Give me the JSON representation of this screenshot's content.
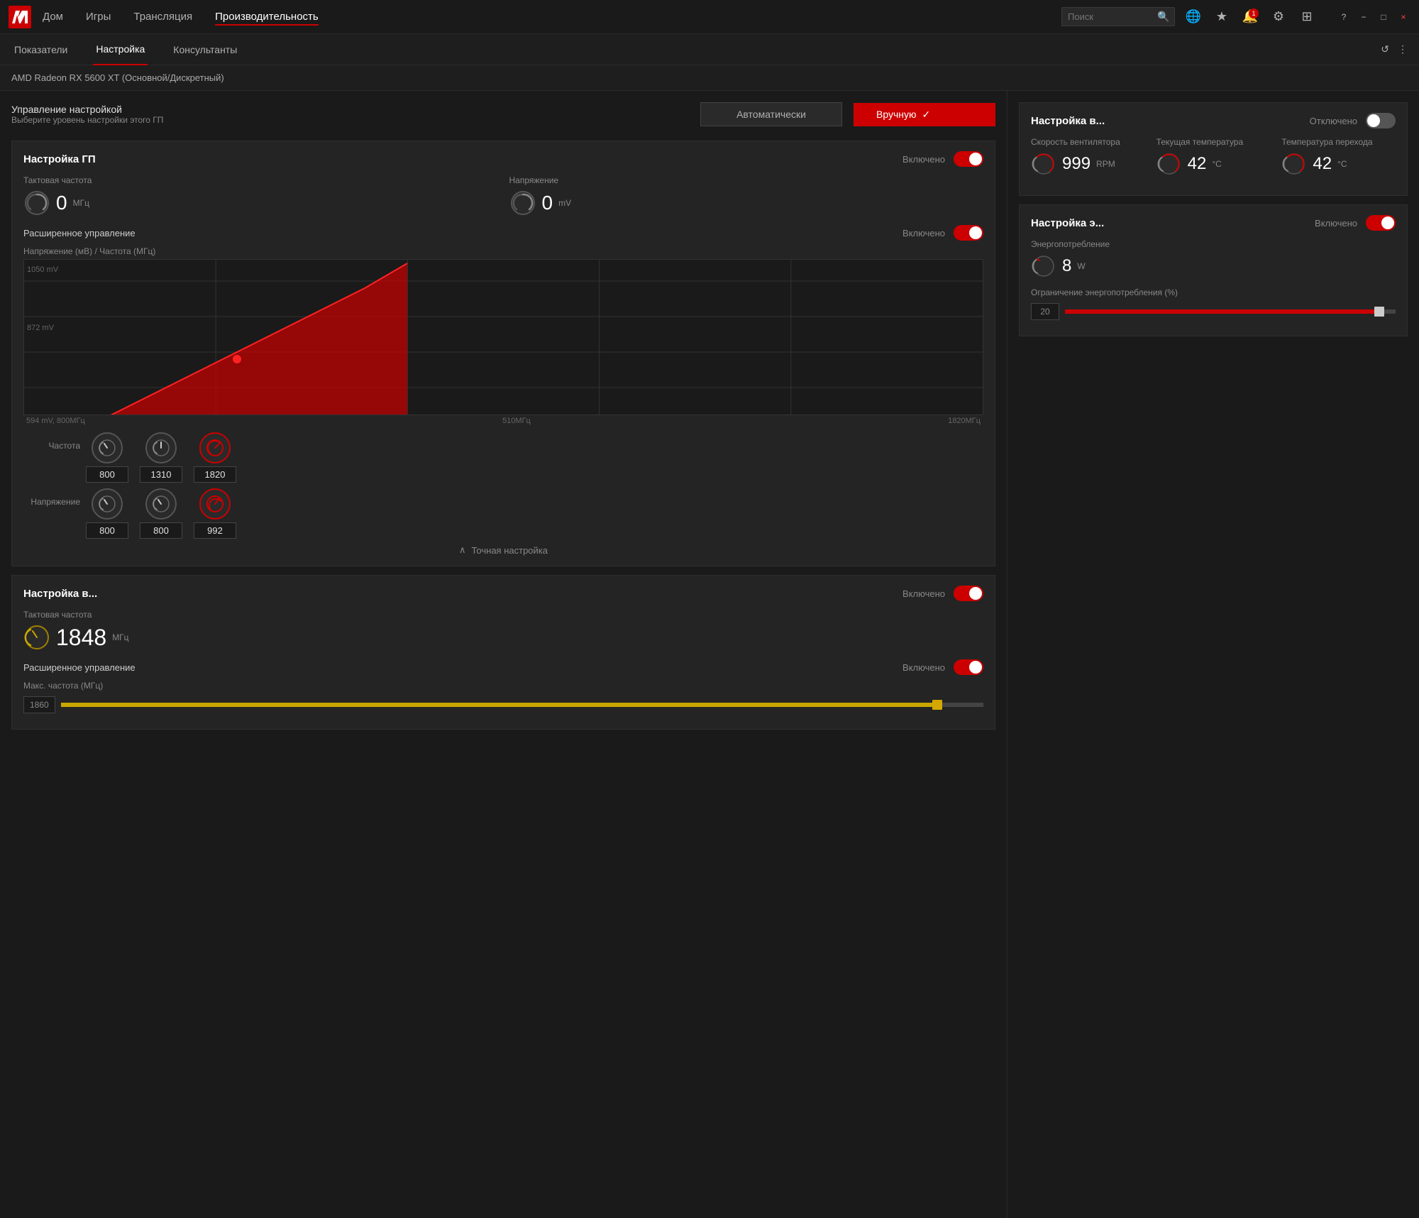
{
  "titleBar": {
    "logo": "AMD",
    "nav": [
      {
        "label": "Дом",
        "active": false
      },
      {
        "label": "Игры",
        "active": false
      },
      {
        "label": "Трансляция",
        "active": false
      },
      {
        "label": "Производительность",
        "active": true
      }
    ],
    "search": {
      "placeholder": "Поиск"
    },
    "notifCount": "1",
    "windowControls": [
      "?",
      "−",
      "□",
      "×"
    ]
  },
  "tabs": [
    {
      "label": "Показатели",
      "active": false
    },
    {
      "label": "Настройка",
      "active": true
    },
    {
      "label": "Консультанты",
      "active": false
    }
  ],
  "deviceLabel": "AMD Radeon RX 5600 XT (Основной/Дискретный)",
  "management": {
    "title": "Управление настройкой",
    "subtitle": "Выберите уровень настройки этого ГП",
    "btnAuto": "Автоматически",
    "btnManual": "Вручную",
    "checkmark": "✓"
  },
  "gpuTuning": {
    "title": "Настройка ГП",
    "status": "Включено",
    "toggleOn": true,
    "clockLabel": "Тактовая частота",
    "clockValue": "0",
    "clockUnit": "МГц",
    "voltageLabel": "Напряжение",
    "voltageValue": "0",
    "voltageUnit": "mV",
    "advancedLabel": "Расширенное управление",
    "advancedStatus": "Включено",
    "advancedToggleOn": true,
    "chartLabel": "Напряжение (мВ) / Частота (МГц)",
    "chartYTop": "1050 mV",
    "chartYMid": "872 mV",
    "chartXLeft": "594 mV, 800МГц",
    "chartXMid": "510МГц",
    "chartXRight": "1820МГц",
    "freqLabel": "Частота",
    "freqValues": [
      "800",
      "1310",
      "1820"
    ],
    "voltLabel": "Напряжение",
    "voltValues": [
      "800",
      "800",
      "992"
    ],
    "fineTune": "Точная настройка"
  },
  "vramTuning": {
    "title": "Настройка в...",
    "status": "Включено",
    "toggleOn": true,
    "clockLabel": "Тактовая частота",
    "clockValue": "1848",
    "clockUnit": "МГц",
    "advancedLabel": "Расширенное управление",
    "advancedStatus": "Включено",
    "advancedToggleOn": true,
    "maxFreqLabel": "Макс. частота (МГц)",
    "sliderValue": "1860",
    "sliderPct": 95
  },
  "fanTuning": {
    "title": "Настройка в...",
    "status": "Отключено",
    "toggleOn": false,
    "fanSpeedLabel": "Скорость вентилятора",
    "fanSpeedValue": "999",
    "fanSpeedUnit": "RPM",
    "curTempLabel": "Текущая температура",
    "curTempValue": "42",
    "curTempUnit": "°С",
    "junctionTempLabel": "Температура перехода",
    "junctionTempValue": "42",
    "junctionTempUnit": "°С"
  },
  "powerTuning": {
    "title": "Настройка э...",
    "status": "Включено",
    "toggleOn": true,
    "powerLabel": "Энергопотребление",
    "powerValue": "8",
    "powerUnit": "W",
    "limitLabel": "Ограничение энергопотребления (%)",
    "sliderValue": "20",
    "sliderPct": 95
  }
}
